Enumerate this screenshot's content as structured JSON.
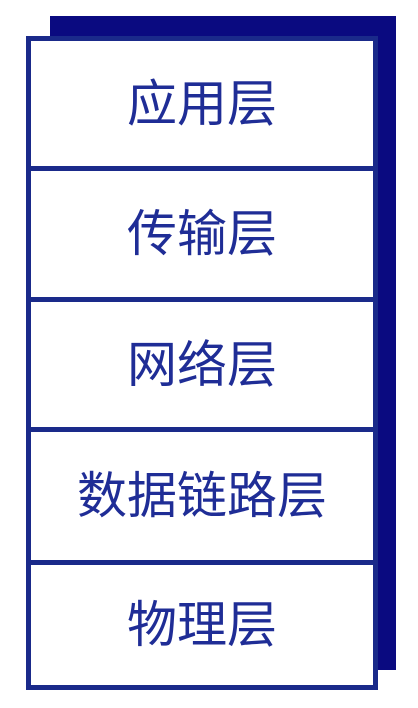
{
  "diagram": {
    "layers": [
      {
        "label": "应用层"
      },
      {
        "label": "传输层"
      },
      {
        "label": "网络层"
      },
      {
        "label": "数据链路层"
      },
      {
        "label": "物理层"
      }
    ]
  },
  "colors": {
    "shadow": "#0a0a80",
    "border": "#1a2a8a",
    "text": "#1f2d96",
    "fill": "#ffffff"
  }
}
